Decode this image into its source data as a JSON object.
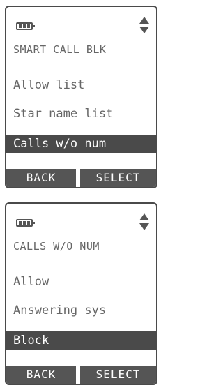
{
  "screens": [
    {
      "title": "SMART CALL BLK",
      "items": [
        "Allow list",
        "Star name list"
      ],
      "selected": "Calls w/o num",
      "softkeys": {
        "back": "BACK",
        "select": "SELECT"
      }
    },
    {
      "title": "CALLS W/O NUM",
      "items": [
        "Allow",
        "Answering sys"
      ],
      "selected": "Block",
      "softkeys": {
        "back": "BACK",
        "select": "SELECT"
      }
    }
  ],
  "icons": {
    "battery": "battery-icon",
    "scroll": "scroll-up-down-icon"
  },
  "colors": {
    "highlight": "#4a4a4a",
    "text": "#666666"
  }
}
